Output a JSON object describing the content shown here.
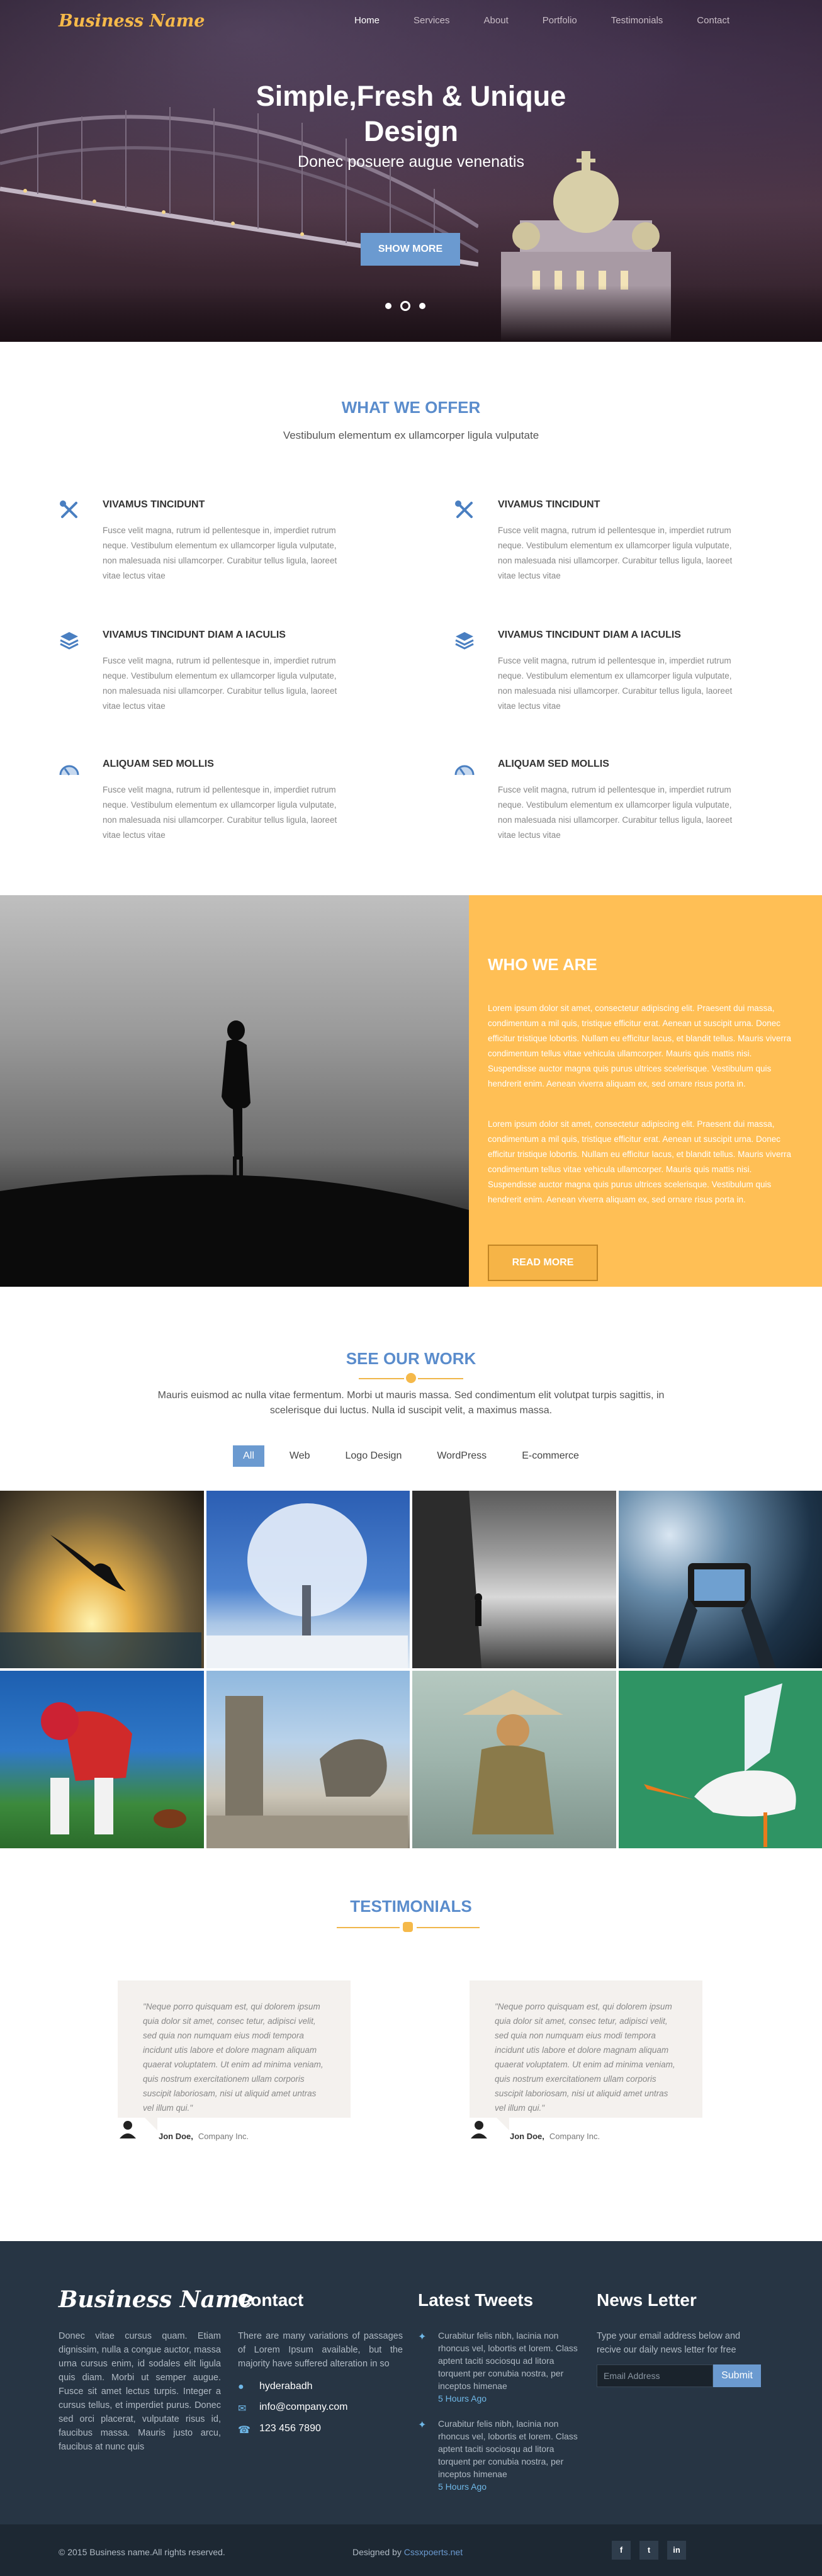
{
  "brand": {
    "name": "Business Name",
    "accent": "#f5b94a",
    "blue": "#6b9ad0"
  },
  "nav": [
    {
      "label": "Home",
      "active": true
    },
    {
      "label": "Services"
    },
    {
      "label": "About"
    },
    {
      "label": "Portfolio"
    },
    {
      "label": "Testimonials"
    },
    {
      "label": "Contact"
    }
  ],
  "hero": {
    "title_line1": "Simple,Fresh & Unique",
    "title_line2": "Design",
    "subtitle": "Donec posuere augue venenatis",
    "button": "SHOW MORE"
  },
  "offer": {
    "title": "WHAT WE OFFER",
    "subtitle": "Vestibulum elementum ex ullamcorper ligula vulputate",
    "items": [
      {
        "icon": "tools-icon",
        "title": "VIVAMUS TINCIDUNT",
        "text": "Fusce velit magna, rutrum id pellentesque in, imperdiet rutrum neque. Vestibulum elementum ex ullamcorper ligula vulputate, non malesuada nisi ullamcorper. Curabitur tellus ligula, laoreet vitae lectus vitae"
      },
      {
        "icon": "tools-icon",
        "title": "VIVAMUS TINCIDUNT",
        "text": "Fusce velit magna, rutrum id pellentesque in, imperdiet rutrum neque. Vestibulum elementum ex ullamcorper ligula vulputate, non malesuada nisi ullamcorper. Curabitur tellus ligula, laoreet vitae lectus vitae"
      },
      {
        "icon": "layers-icon",
        "title": "VIVAMUS TINCIDUNT DIAM A IACULIS",
        "text": "Fusce velit magna, rutrum id pellentesque in, imperdiet rutrum neque. Vestibulum elementum ex ullamcorper ligula vulputate, non malesuada nisi ullamcorper. Curabitur tellus ligula, laoreet vitae lectus vitae"
      },
      {
        "icon": "layers-icon",
        "title": "VIVAMUS TINCIDUNT DIAM A IACULIS",
        "text": "Fusce velit magna, rutrum id pellentesque in, imperdiet rutrum neque. Vestibulum elementum ex ullamcorper ligula vulputate, non malesuada nisi ullamcorper. Curabitur tellus ligula, laoreet vitae lectus vitae"
      },
      {
        "icon": "dashboard-icon",
        "title": "ALIQUAM SED MOLLIS",
        "text": "Fusce velit magna, rutrum id pellentesque in, imperdiet rutrum neque. Vestibulum elementum ex ullamcorper ligula vulputate, non malesuada nisi ullamcorper. Curabitur tellus ligula, laoreet vitae lectus vitae"
      },
      {
        "icon": "dashboard-icon",
        "title": "ALIQUAM SED MOLLIS",
        "text": "Fusce velit magna, rutrum id pellentesque in, imperdiet rutrum neque. Vestibulum elementum ex ullamcorper ligula vulputate, non malesuada nisi ullamcorper. Curabitur tellus ligula, laoreet vitae lectus vitae"
      }
    ]
  },
  "who": {
    "title": "WHO WE ARE",
    "p1": "Lorem ipsum dolor sit amet, consectetur adipiscing elit. Praesent dui massa, condimentum a mil quis, tristique efficitur erat. Aenean ut suscipit urna. Donec efficitur tristique lobortis. Nullam eu efficitur lacus, et blandit tellus. Mauris viverra condimentum tellus vitae vehicula ullamcorper. Mauris quis mattis nisi. Suspendisse auctor magna quis purus ultrices scelerisque. Vestibulum quis hendrerit enim. Aenean viverra aliquam ex, sed ornare risus porta in.",
    "p2": "Lorem ipsum dolor sit amet, consectetur adipiscing elit. Praesent dui massa, condimentum a mil quis, tristique efficitur erat. Aenean ut suscipit urna. Donec efficitur tristique lobortis. Nullam eu efficitur lacus, et blandit tellus. Mauris viverra condimentum tellus vitae vehicula ullamcorper. Mauris quis mattis nisi. Suspendisse auctor magna quis purus ultrices scelerisque. Vestibulum quis hendrerit enim. Aenean viverra aliquam ex, sed ornare risus porta in.",
    "button": "READ MORE"
  },
  "work": {
    "title": "SEE OUR WORK",
    "subtitle_line1": "Mauris euismod ac nulla vitae fermentum. Morbi ut mauris massa. Sed condimentum elit volutpat turpis sagittis, in",
    "subtitle_line2": "scelerisque dui luctus. Nulla id suscipit velit, a maximus massa.",
    "filters": [
      "All",
      "Web",
      "Logo Design",
      "WordPress",
      "E-commerce"
    ]
  },
  "testimonials": {
    "title": "TESTIMONIALS",
    "items": [
      {
        "quote": "\"Neque porro quisquam est, qui dolorem ipsum quia dolor sit amet, consec tetur, adipisci velit, sed quia non numquam eius modi tempora incidunt utis labore et dolore magnam aliquam quaerat voluptatem. Ut enim ad minima veniam, quis nostrum exercitationem ullam corporis suscipit laboriosam, nisi ut aliquid amet untras vel illum qui.\"",
        "name": "Jon Doe,",
        "company": "Company Inc."
      },
      {
        "quote": "\"Neque porro quisquam est, qui dolorem ipsum quia dolor sit amet, consec tetur, adipisci velit, sed quia non numquam eius modi tempora incidunt utis labore et dolore magnam aliquam quaerat voluptatem. Ut enim ad minima veniam, quis nostrum exercitationem ullam corporis suscipit laboriosam, nisi ut aliquid amet untras vel illum qui.\"",
        "name": "Jon Doe,",
        "company": "Company Inc."
      }
    ]
  },
  "footer": {
    "about": "Donec vitae cursus quam. Etiam dignissim, nulla a congue auctor, massa urna cursus enim, id sodales elit ligula quis diam. Morbi ut semper augue. Fusce sit amet lectus turpis. Integer a cursus tellus, et imperdiet purus. Donec sed orci placerat, vulputate risus id, faucibus massa. Mauris justo arcu, faucibus at nunc quis",
    "contact_title": "Contact",
    "contact_text": "There are many variations of passages of Lorem Ipsum available, but the majority have suffered alteration in so",
    "address": "hyderabadh",
    "email": "info@company.com",
    "phone": "123 456 7890",
    "tweets_title": "Latest Tweets",
    "tweets": [
      {
        "text": "Curabitur felis nibh, lacinia non rhoncus vel, lobortis et lorem. Class aptent taciti sociosqu ad litora torquent per conubia nostra, per inceptos himenae",
        "time": "5 Hours Ago"
      },
      {
        "text": "Curabitur felis nibh, lacinia non rhoncus vel, lobortis et lorem. Class aptent taciti sociosqu ad litora torquent per conubia nostra, per inceptos himenae",
        "time": "5 Hours Ago"
      }
    ],
    "news_title": "News Letter",
    "news_text": "Type your email address below and recive our daily news letter for free",
    "email_placeholder": "Email Address",
    "submit": "Submit",
    "copyright": "© 2015 Business name.All rights reserved.",
    "designed_by": "Designed by ",
    "designer": "Cssxpoerts.net",
    "social": [
      "f",
      "t",
      "in"
    ]
  }
}
